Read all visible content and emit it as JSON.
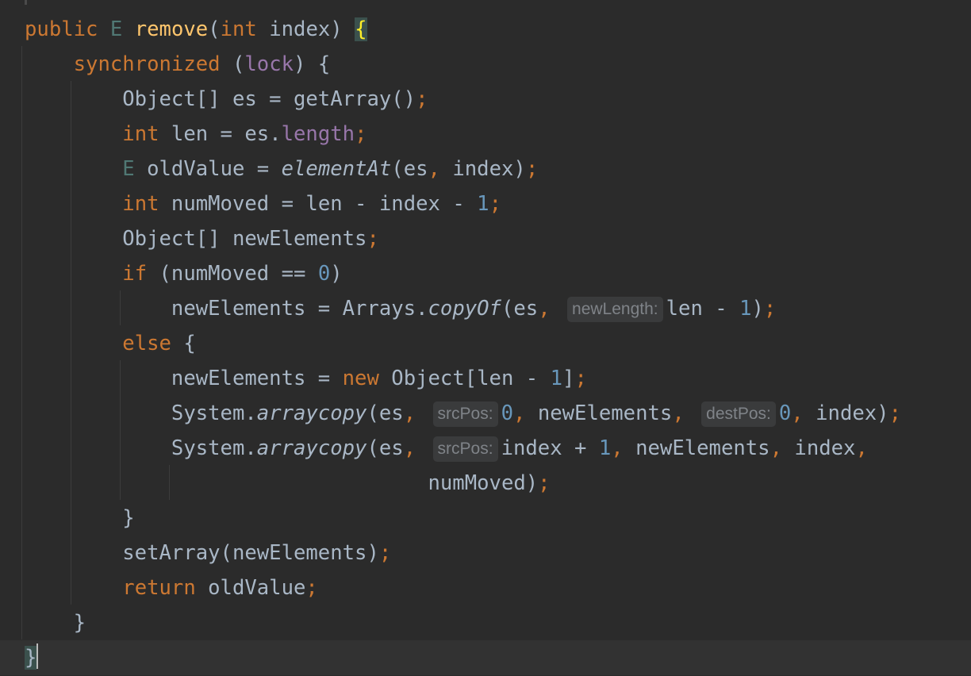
{
  "editor": {
    "lines": [
      {
        "tokens": [
          {
            "t": "public",
            "c": "kw"
          },
          {
            "t": " "
          },
          {
            "t": "E",
            "c": "tp"
          },
          {
            "t": " "
          },
          {
            "t": "remove",
            "c": "fn"
          },
          {
            "t": "("
          },
          {
            "t": "int",
            "c": "kw"
          },
          {
            "t": " index) "
          },
          {
            "t": "{",
            "c": "brace-hl"
          }
        ]
      },
      {
        "tokens": [
          {
            "t": "    "
          },
          {
            "t": "synchronized",
            "c": "kw"
          },
          {
            "t": " ("
          },
          {
            "t": "lock",
            "c": "fd"
          },
          {
            "t": ") {"
          }
        ]
      },
      {
        "tokens": [
          {
            "t": "        Object[] es = getArray()"
          },
          {
            "t": ";",
            "c": "punc"
          }
        ]
      },
      {
        "tokens": [
          {
            "t": "        "
          },
          {
            "t": "int",
            "c": "kw"
          },
          {
            "t": " len = es."
          },
          {
            "t": "length",
            "c": "fd"
          },
          {
            "t": ";",
            "c": "punc"
          }
        ]
      },
      {
        "tokens": [
          {
            "t": "        "
          },
          {
            "t": "E",
            "c": "tp"
          },
          {
            "t": " oldValue = "
          },
          {
            "t": "elementAt",
            "c": "it"
          },
          {
            "t": "(es"
          },
          {
            "t": ",",
            "c": "punc"
          },
          {
            "t": " index)"
          },
          {
            "t": ";",
            "c": "punc"
          }
        ]
      },
      {
        "tokens": [
          {
            "t": "        "
          },
          {
            "t": "int",
            "c": "kw"
          },
          {
            "t": " numMoved = len - index - "
          },
          {
            "t": "1",
            "c": "num"
          },
          {
            "t": ";",
            "c": "punc"
          }
        ]
      },
      {
        "tokens": [
          {
            "t": "        Object[] newElements"
          },
          {
            "t": ";",
            "c": "punc"
          }
        ]
      },
      {
        "tokens": [
          {
            "t": "        "
          },
          {
            "t": "if",
            "c": "kw"
          },
          {
            "t": " (numMoved == "
          },
          {
            "t": "0",
            "c": "num"
          },
          {
            "t": ")"
          }
        ]
      },
      {
        "tokens": [
          {
            "t": "            newElements = Arrays."
          },
          {
            "t": "copyOf",
            "c": "it"
          },
          {
            "t": "(es"
          },
          {
            "t": ",",
            "c": "punc"
          },
          {
            "t": " "
          },
          {
            "t": "newLength:",
            "c": "hint"
          },
          {
            "t": "len - "
          },
          {
            "t": "1",
            "c": "num"
          },
          {
            "t": ")"
          },
          {
            "t": ";",
            "c": "punc"
          }
        ]
      },
      {
        "tokens": [
          {
            "t": "        "
          },
          {
            "t": "else",
            "c": "kw"
          },
          {
            "t": " {"
          }
        ]
      },
      {
        "tokens": [
          {
            "t": "            newElements = "
          },
          {
            "t": "new",
            "c": "kw"
          },
          {
            "t": " Object[len - "
          },
          {
            "t": "1",
            "c": "num"
          },
          {
            "t": "]"
          },
          {
            "t": ";",
            "c": "punc"
          }
        ]
      },
      {
        "tokens": [
          {
            "t": "            System."
          },
          {
            "t": "arraycopy",
            "c": "it"
          },
          {
            "t": "(es"
          },
          {
            "t": ",",
            "c": "punc"
          },
          {
            "t": " "
          },
          {
            "t": "srcPos:",
            "c": "hint"
          },
          {
            "t": "0",
            "c": "num"
          },
          {
            "t": ",",
            "c": "punc"
          },
          {
            "t": " newElements"
          },
          {
            "t": ",",
            "c": "punc"
          },
          {
            "t": " "
          },
          {
            "t": "destPos:",
            "c": "hint"
          },
          {
            "t": "0",
            "c": "num"
          },
          {
            "t": ",",
            "c": "punc"
          },
          {
            "t": " index)"
          },
          {
            "t": ";",
            "c": "punc"
          }
        ]
      },
      {
        "tokens": [
          {
            "t": "            System."
          },
          {
            "t": "arraycopy",
            "c": "it"
          },
          {
            "t": "(es"
          },
          {
            "t": ",",
            "c": "punc"
          },
          {
            "t": " "
          },
          {
            "t": "srcPos:",
            "c": "hint"
          },
          {
            "t": "index + "
          },
          {
            "t": "1",
            "c": "num"
          },
          {
            "t": ",",
            "c": "punc"
          },
          {
            "t": " newElements"
          },
          {
            "t": ",",
            "c": "punc"
          },
          {
            "t": " index"
          },
          {
            "t": ",",
            "c": "punc"
          }
        ]
      },
      {
        "tokens": [
          {
            "t": "                                 numMoved)"
          },
          {
            "t": ";",
            "c": "punc"
          }
        ]
      },
      {
        "tokens": [
          {
            "t": "        }"
          }
        ]
      },
      {
        "tokens": [
          {
            "t": "        setArray(newElements)"
          },
          {
            "t": ";",
            "c": "punc"
          }
        ]
      },
      {
        "tokens": [
          {
            "t": "        "
          },
          {
            "t": "return",
            "c": "kw"
          },
          {
            "t": " oldValue"
          },
          {
            "t": ";",
            "c": "punc"
          }
        ]
      },
      {
        "tokens": [
          {
            "t": "    }"
          }
        ]
      },
      {
        "tokens": [
          {
            "t": "}",
            "c": "caret-brace"
          }
        ]
      }
    ]
  },
  "colors": {
    "background": "#2b2b2b",
    "keyword": "#cc7832",
    "method_decl": "#ffc66d",
    "type_param": "#507874",
    "field": "#9876aa",
    "number": "#6897bb",
    "text": "#a9b7c6"
  }
}
